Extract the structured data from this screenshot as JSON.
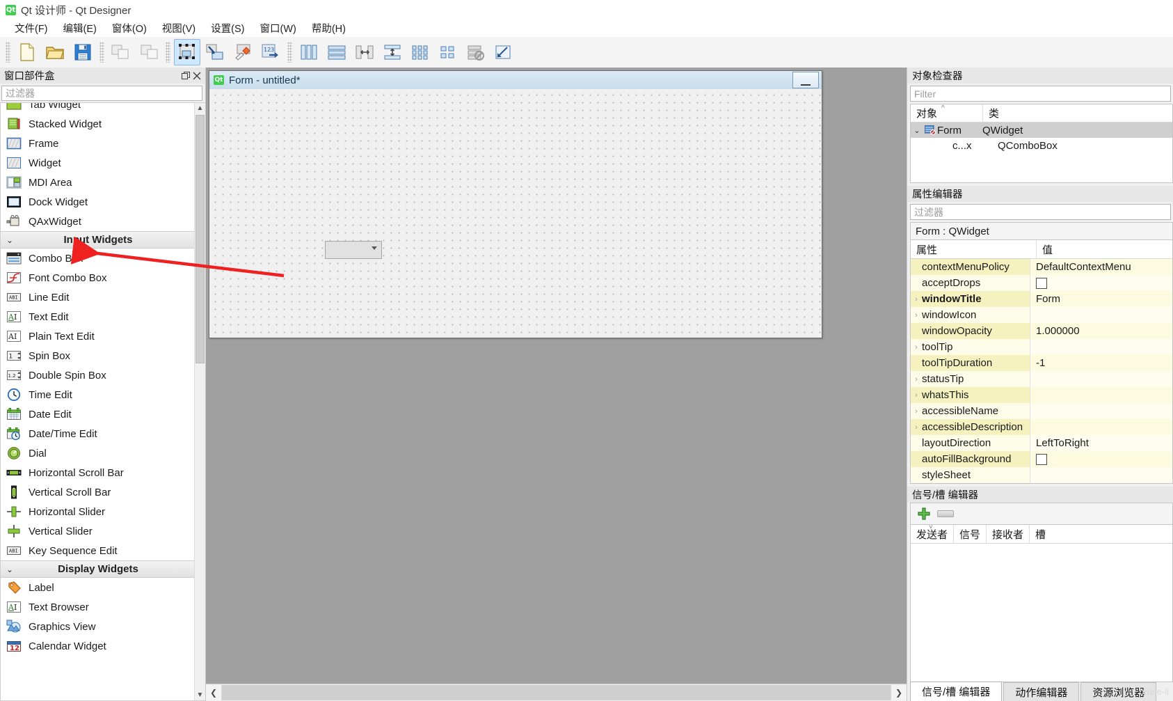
{
  "window": {
    "title": "Qt 设计师 - Qt Designer",
    "logo": "Qt"
  },
  "menubar": {
    "items": [
      {
        "label": "文件(F)",
        "key": "F"
      },
      {
        "label": "编辑(E)",
        "key": "E"
      },
      {
        "label": "窗体(O)",
        "key": "O"
      },
      {
        "label": "视图(V)",
        "key": "V"
      },
      {
        "label": "设置(S)",
        "key": "S"
      },
      {
        "label": "窗口(W)",
        "key": "W"
      },
      {
        "label": "帮助(H)",
        "key": "H"
      }
    ]
  },
  "toolbar": {
    "groups": [
      [
        "new-file-icon",
        "open-folder-icon",
        "save-icon"
      ],
      [
        "undo-icon",
        "redo-icon"
      ],
      [
        "edit-widgets-icon",
        "edit-signals-slots-icon",
        "edit-buddies-icon",
        "edit-tab-order-icon"
      ],
      [
        "layout-horizontally-icon",
        "layout-vertically-icon",
        "layout-splitter-h-icon",
        "layout-splitter-v-icon",
        "layout-grid-icon",
        "layout-form-icon",
        "break-layout-icon",
        "adjust-size-icon"
      ]
    ],
    "active": "edit-widgets-icon"
  },
  "widget_box": {
    "title": "窗口部件盒",
    "filter_placeholder": "过滤器",
    "undock_icon": "undock-icon",
    "close_icon": "close-icon",
    "items": [
      {
        "label": "Tab Widget",
        "icon": "tab-widget-icon",
        "type": "item",
        "clipped": true
      },
      {
        "label": "Stacked Widget",
        "icon": "stacked-widget-icon",
        "type": "item"
      },
      {
        "label": "Frame",
        "icon": "frame-icon",
        "type": "item"
      },
      {
        "label": "Widget",
        "icon": "widget-icon",
        "type": "item"
      },
      {
        "label": "MDI Area",
        "icon": "mdi-area-icon",
        "type": "item"
      },
      {
        "label": "Dock Widget",
        "icon": "dock-widget-icon",
        "type": "item"
      },
      {
        "label": "QAxWidget",
        "icon": "qaxwidget-icon",
        "type": "item"
      },
      {
        "label": "Input Widgets",
        "icon": "chevron-down-icon",
        "type": "group"
      },
      {
        "label": "Combo Box",
        "icon": "combo-box-icon",
        "type": "item",
        "highlighted": true
      },
      {
        "label": "Font Combo Box",
        "icon": "font-combo-box-icon",
        "type": "item"
      },
      {
        "label": "Line Edit",
        "icon": "line-edit-icon",
        "type": "item"
      },
      {
        "label": "Text Edit",
        "icon": "text-edit-icon",
        "type": "item"
      },
      {
        "label": "Plain Text Edit",
        "icon": "plain-text-edit-icon",
        "type": "item"
      },
      {
        "label": "Spin Box",
        "icon": "spin-box-icon",
        "type": "item"
      },
      {
        "label": "Double Spin Box",
        "icon": "double-spin-box-icon",
        "type": "item"
      },
      {
        "label": "Time Edit",
        "icon": "time-edit-icon",
        "type": "item"
      },
      {
        "label": "Date Edit",
        "icon": "date-edit-icon",
        "type": "item"
      },
      {
        "label": "Date/Time Edit",
        "icon": "date-time-edit-icon",
        "type": "item"
      },
      {
        "label": "Dial",
        "icon": "dial-icon",
        "type": "item"
      },
      {
        "label": "Horizontal Scroll Bar",
        "icon": "horizontal-scroll-bar-icon",
        "type": "item"
      },
      {
        "label": "Vertical Scroll Bar",
        "icon": "vertical-scroll-bar-icon",
        "type": "item"
      },
      {
        "label": "Horizontal Slider",
        "icon": "horizontal-slider-icon",
        "type": "item"
      },
      {
        "label": "Vertical Slider",
        "icon": "vertical-slider-icon",
        "type": "item"
      },
      {
        "label": "Key Sequence Edit",
        "icon": "key-sequence-edit-icon",
        "type": "item"
      },
      {
        "label": "Display Widgets",
        "icon": "chevron-down-icon",
        "type": "group"
      },
      {
        "label": "Label",
        "icon": "label-icon",
        "type": "item"
      },
      {
        "label": "Text Browser",
        "icon": "text-browser-icon",
        "type": "item"
      },
      {
        "label": "Graphics View",
        "icon": "graphics-view-icon",
        "type": "item"
      },
      {
        "label": "Calendar Widget",
        "icon": "calendar-widget-icon",
        "type": "item"
      }
    ]
  },
  "form_window": {
    "title": "Form - untitled*",
    "logo": "Qt",
    "minimize_icon": "minimize-icon",
    "combo_box": {
      "name": "comboBox",
      "arrow": "chevron-down-icon"
    }
  },
  "object_inspector": {
    "title": "对象检查器",
    "filter_placeholder": "Filter",
    "columns": [
      "对象",
      "类"
    ],
    "rows": [
      {
        "name": "Form",
        "class": "QWidget",
        "level": 0,
        "expanded": true,
        "selected": true,
        "icon": "form-icon"
      },
      {
        "name": "c...x",
        "class": "QComboBox",
        "level": 1,
        "expanded": false,
        "selected": false,
        "icon": ""
      }
    ]
  },
  "property_editor": {
    "title": "属性编辑器",
    "filter_placeholder": "过滤器",
    "subject": "Form : QWidget",
    "columns": [
      "属性",
      "值"
    ],
    "rows": [
      {
        "name": "contextMenuPolicy",
        "value": "DefaultContextMenu",
        "expandable": false,
        "bold": false,
        "checkbox": false
      },
      {
        "name": "acceptDrops",
        "value": "",
        "expandable": false,
        "bold": false,
        "checkbox": true
      },
      {
        "name": "windowTitle",
        "value": "Form",
        "expandable": true,
        "bold": true,
        "checkbox": false
      },
      {
        "name": "windowIcon",
        "value": "",
        "expandable": true,
        "bold": false,
        "checkbox": false
      },
      {
        "name": "windowOpacity",
        "value": "1.000000",
        "expandable": false,
        "bold": false,
        "checkbox": false
      },
      {
        "name": "toolTip",
        "value": "",
        "expandable": true,
        "bold": false,
        "checkbox": false
      },
      {
        "name": "toolTipDuration",
        "value": "-1",
        "expandable": false,
        "bold": false,
        "checkbox": false
      },
      {
        "name": "statusTip",
        "value": "",
        "expandable": true,
        "bold": false,
        "checkbox": false
      },
      {
        "name": "whatsThis",
        "value": "",
        "expandable": true,
        "bold": false,
        "checkbox": false
      },
      {
        "name": "accessibleName",
        "value": "",
        "expandable": true,
        "bold": false,
        "checkbox": false
      },
      {
        "name": "accessibleDescription",
        "value": "",
        "expandable": true,
        "bold": false,
        "checkbox": false
      },
      {
        "name": "layoutDirection",
        "value": "LeftToRight",
        "expandable": false,
        "bold": false,
        "checkbox": false
      },
      {
        "name": "autoFillBackground",
        "value": "",
        "expandable": false,
        "bold": false,
        "checkbox": true
      },
      {
        "name": "styleSheet",
        "value": "",
        "expandable": false,
        "bold": false,
        "checkbox": false
      }
    ]
  },
  "signal_slot_editor": {
    "title": "信号/槽 编辑器",
    "add_icon": "plus-icon",
    "remove_icon": "minus-icon",
    "columns": [
      "发送者",
      "信号",
      "接收者",
      "槽"
    ],
    "rows": []
  },
  "bottom_tabs": {
    "tabs": [
      {
        "label": "信号/槽 编辑器",
        "active": true
      },
      {
        "label": "动作编辑器",
        "active": false
      },
      {
        "label": "资源浏览器",
        "active": false
      }
    ]
  },
  "watermark": "bruce-li",
  "colors": {
    "accent": "#41cd52",
    "toolbar_active": "#cde8ff",
    "property_row": "#fcfbe0",
    "mdi_background": "#a0a0a0",
    "annotation_arrow": "#ee2020"
  }
}
